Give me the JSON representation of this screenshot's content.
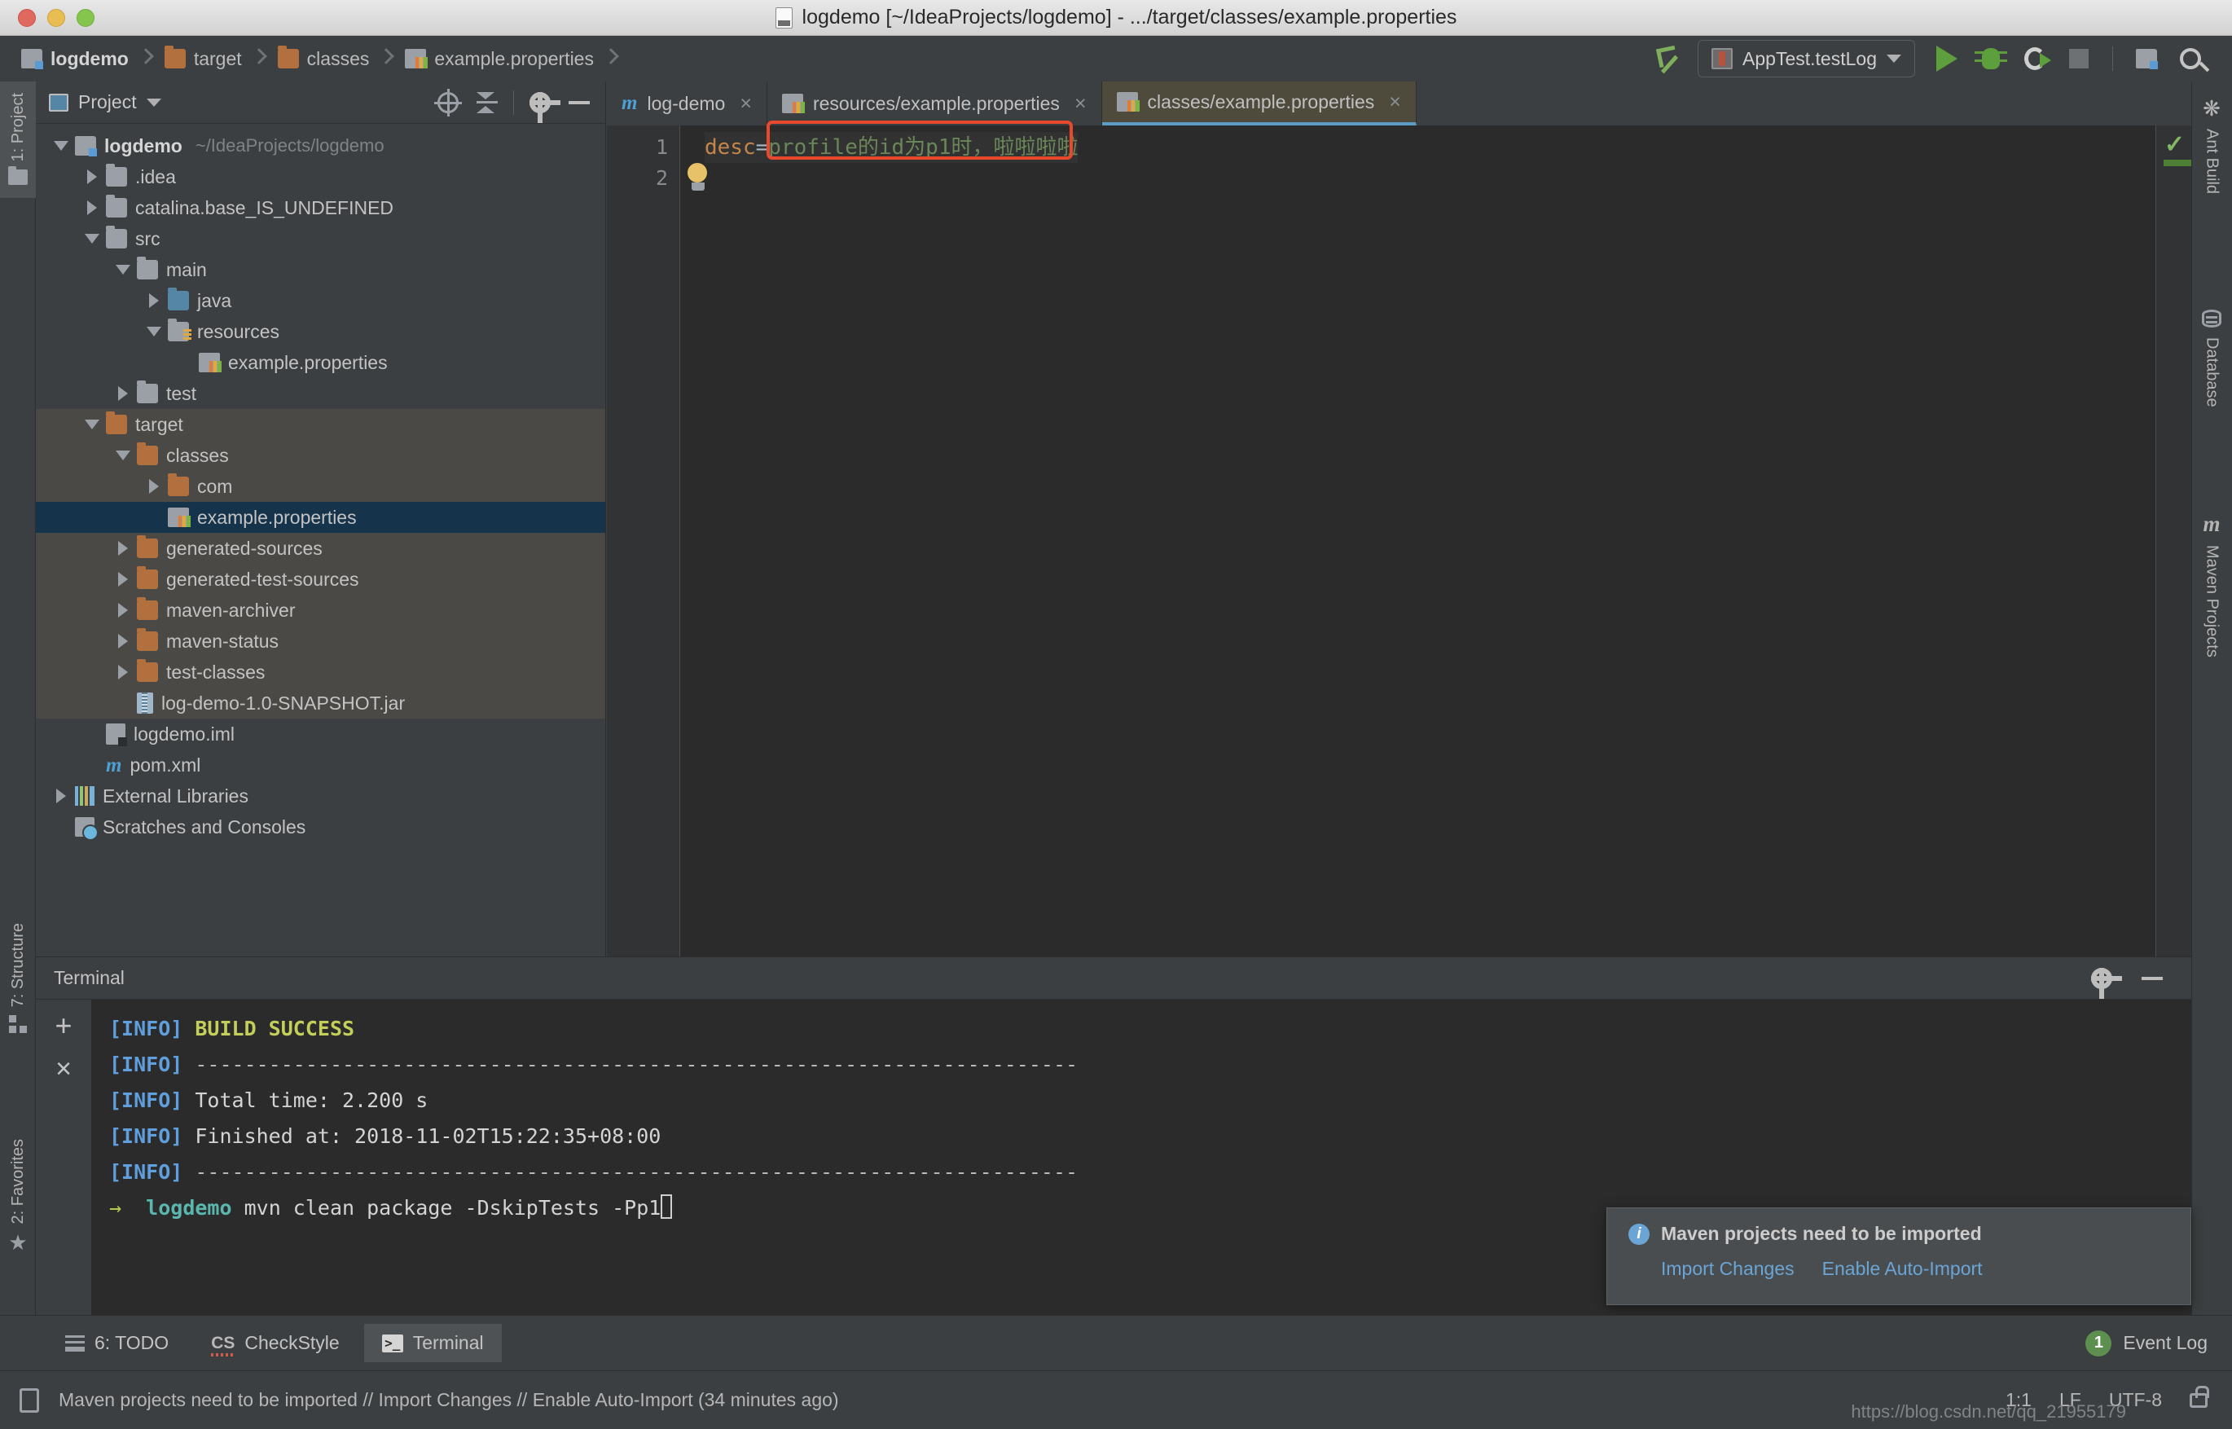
{
  "window": {
    "title": "logdemo [~/IdeaProjects/logdemo] - .../target/classes/example.properties",
    "file_icon": "java-file-icon"
  },
  "breadcrumb": [
    {
      "label": "logdemo",
      "icon": "module-icon",
      "bold": true
    },
    {
      "label": "target",
      "icon": "folder-icon",
      "bold": false
    },
    {
      "label": "classes",
      "icon": "folder-icon",
      "bold": false
    },
    {
      "label": "example.properties",
      "icon": "properties-icon",
      "bold": false
    }
  ],
  "toolbar": {
    "back_icon": "navigate-back-icon",
    "run_config": {
      "label": "AppTest.testLog",
      "icon": "run-config-icon",
      "caret": "chevron-down-icon"
    },
    "run_icon": "run-icon",
    "debug_icon": "debug-icon",
    "coverage_icon": "run-with-coverage-icon",
    "stop_icon": "stop-icon",
    "project_structure_icon": "project-structure-icon",
    "search_icon": "search-everywhere-icon"
  },
  "left_strip": [
    {
      "label": "1: Project",
      "icon": "folder-icon",
      "selected": true
    },
    {
      "label": "7: Structure",
      "icon": "structure-icon",
      "selected": false
    },
    {
      "label": "2: Favorites",
      "icon": "star-icon",
      "selected": false
    }
  ],
  "right_strip": [
    {
      "label": "Ant Build",
      "icon": "ant-icon"
    },
    {
      "label": "Database",
      "icon": "database-icon"
    },
    {
      "label": "Maven Projects",
      "icon": "maven-icon"
    }
  ],
  "project_panel": {
    "title": "Project",
    "title_icon": "project-view-icon",
    "caret": "chevron-down-icon",
    "tools": [
      "locate-icon",
      "collapse-all-icon",
      "settings-gear-icon",
      "hide-icon"
    ],
    "tree": [
      {
        "indent": 0,
        "twisty": "down",
        "icon": "module-icon",
        "label": "logdemo",
        "bold": true,
        "path": "~/IdeaProjects/logdemo",
        "state": "normal"
      },
      {
        "indent": 1,
        "twisty": "right",
        "icon": "folder-grey",
        "label": ".idea",
        "state": "normal"
      },
      {
        "indent": 1,
        "twisty": "right",
        "icon": "folder-grey",
        "label": "catalina.base_IS_UNDEFINED",
        "state": "normal"
      },
      {
        "indent": 1,
        "twisty": "down",
        "icon": "folder-grey",
        "label": "src",
        "state": "normal"
      },
      {
        "indent": 2,
        "twisty": "down",
        "icon": "folder-grey",
        "label": "main",
        "state": "normal"
      },
      {
        "indent": 3,
        "twisty": "right",
        "icon": "folder-blue",
        "label": "java",
        "state": "normal"
      },
      {
        "indent": 3,
        "twisty": "down",
        "icon": "resources-icon",
        "label": "resources",
        "state": "normal"
      },
      {
        "indent": 4,
        "twisty": "none",
        "icon": "properties-icon",
        "label": "example.properties",
        "state": "normal"
      },
      {
        "indent": 2,
        "twisty": "right",
        "icon": "folder-grey",
        "label": "test",
        "state": "normal"
      },
      {
        "indent": 1,
        "twisty": "down",
        "icon": "folder-orange",
        "label": "target",
        "state": "shaded"
      },
      {
        "indent": 2,
        "twisty": "down",
        "icon": "folder-orange",
        "label": "classes",
        "state": "shaded"
      },
      {
        "indent": 3,
        "twisty": "right",
        "icon": "folder-orange",
        "label": "com",
        "state": "shaded"
      },
      {
        "indent": 3,
        "twisty": "none",
        "icon": "properties-icon",
        "label": "example.properties",
        "state": "selected"
      },
      {
        "indent": 2,
        "twisty": "right",
        "icon": "folder-orange",
        "label": "generated-sources",
        "state": "shaded"
      },
      {
        "indent": 2,
        "twisty": "right",
        "icon": "folder-orange",
        "label": "generated-test-sources",
        "state": "shaded"
      },
      {
        "indent": 2,
        "twisty": "right",
        "icon": "folder-orange",
        "label": "maven-archiver",
        "state": "shaded"
      },
      {
        "indent": 2,
        "twisty": "right",
        "icon": "folder-orange",
        "label": "maven-status",
        "state": "shaded"
      },
      {
        "indent": 2,
        "twisty": "right",
        "icon": "folder-orange",
        "label": "test-classes",
        "state": "shaded"
      },
      {
        "indent": 2,
        "twisty": "none",
        "icon": "jar-icon",
        "label": "log-demo-1.0-SNAPSHOT.jar",
        "state": "shaded"
      },
      {
        "indent": 1,
        "twisty": "none",
        "icon": "iml-icon",
        "label": "logdemo.iml",
        "state": "normal"
      },
      {
        "indent": 1,
        "twisty": "none",
        "icon": "maven-pom-icon",
        "label": "pom.xml",
        "state": "normal"
      },
      {
        "indent": 0,
        "twisty": "right",
        "icon": "libraries-icon",
        "label": "External Libraries",
        "state": "normal"
      },
      {
        "indent": 0,
        "twisty": "none",
        "icon": "scratches-icon",
        "label": "Scratches and Consoles",
        "state": "normal"
      }
    ]
  },
  "editor": {
    "tabs": [
      {
        "label": "log-demo",
        "icon": "maven-pom-icon",
        "active": false,
        "close": "×"
      },
      {
        "label": "resources/example.properties",
        "icon": "properties-icon",
        "active": false,
        "close": "×"
      },
      {
        "label": "classes/example.properties",
        "icon": "properties-icon",
        "active": true,
        "close": "×"
      }
    ],
    "line_numbers": [
      "1",
      "2"
    ],
    "gutter_icon": "intention-bulb-icon",
    "line1": {
      "key": "desc",
      "eq": "=",
      "value": "profile的id为p1时，啦啦啦啦"
    },
    "inspection_status": "ok",
    "highlight_annotation_color": "#e8492c"
  },
  "terminal": {
    "title": "Terminal",
    "tools": [
      "settings-gear-icon",
      "hide-icon"
    ],
    "side_buttons": [
      "new-session-icon",
      "close-session-icon"
    ],
    "lines": [
      {
        "type": "info-success",
        "tag": "[INFO]",
        "text": "BUILD SUCCESS"
      },
      {
        "type": "info-dash",
        "tag": "[INFO]",
        "text": "------------------------------------------------------------------------"
      },
      {
        "type": "info",
        "tag": "[INFO]",
        "text": "Total time: 2.200 s"
      },
      {
        "type": "info",
        "tag": "[INFO]",
        "text": "Finished at: 2018-11-02T15:22:35+08:00"
      },
      {
        "type": "info-dash",
        "tag": "[INFO]",
        "text": "------------------------------------------------------------------------"
      }
    ],
    "prompt": {
      "arrow": "→",
      "host": "logdemo",
      "command": "mvn clean package -DskipTests -Pp1"
    }
  },
  "notification": {
    "icon": "info-icon",
    "title": "Maven projects need to be imported",
    "links": [
      "Import Changes",
      "Enable Auto-Import"
    ]
  },
  "bottom_tools": [
    {
      "label": "6: TODO",
      "icon": "todo-icon",
      "active": false
    },
    {
      "label": "CheckStyle",
      "icon": "checkstyle-icon",
      "active": false
    },
    {
      "label": "Terminal",
      "icon": "terminal-icon",
      "active": true
    }
  ],
  "event_log": {
    "count": "1",
    "label": "Event Log"
  },
  "status_bar": {
    "icon": "notification-icon",
    "message": "Maven projects need to be imported // Import Changes // Enable Auto-Import (34 minutes ago)",
    "caret_position": "1:1",
    "line_separator": "LF",
    "encoding": "UTF-8",
    "lock_icon": "read-only-lock-icon",
    "watermark": "https://blog.csdn.net/qq_21955179"
  }
}
